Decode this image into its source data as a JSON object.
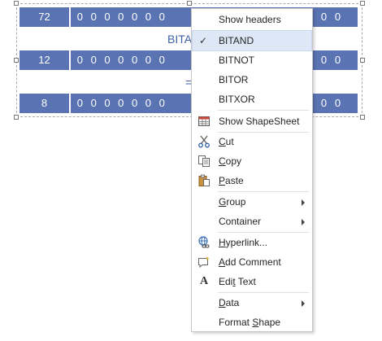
{
  "diagram": {
    "rows": [
      {
        "number": "72",
        "bits_left": [
          "0",
          "0",
          "0",
          "0",
          "0",
          "0",
          "0"
        ],
        "bits_right": [
          "0",
          "0"
        ]
      },
      {
        "number": "12",
        "bits_left": [
          "0",
          "0",
          "0",
          "0",
          "0",
          "0",
          "0"
        ],
        "bits_right": [
          "0",
          "0"
        ]
      },
      {
        "number": "8",
        "bits_left": [
          "0",
          "0",
          "0",
          "0",
          "0",
          "0",
          "0"
        ],
        "bits_right": [
          "0",
          "0"
        ]
      }
    ],
    "operation_label": "BITA",
    "equals_label": "="
  },
  "menu": {
    "items": [
      {
        "label": "Show headers",
        "icon": "",
        "checked": false,
        "submenu": false,
        "highlight": false
      },
      {
        "label": "BITAND",
        "icon": "check-icon",
        "checked": true,
        "submenu": false,
        "highlight": true
      },
      {
        "label": "BITNOT",
        "icon": "",
        "checked": false,
        "submenu": false,
        "highlight": false
      },
      {
        "label": "BITOR",
        "icon": "",
        "checked": false,
        "submenu": false,
        "highlight": false
      },
      {
        "label": "BITXOR",
        "icon": "",
        "checked": false,
        "submenu": false,
        "highlight": false
      },
      {
        "label": "Show ShapeSheet",
        "icon": "shapesheet-icon",
        "checked": false,
        "submenu": false,
        "highlight": false
      },
      {
        "label": "Cut",
        "icon": "scissors-icon",
        "checked": false,
        "submenu": false,
        "highlight": false
      },
      {
        "label": "Copy",
        "icon": "copy-icon",
        "checked": false,
        "submenu": false,
        "highlight": false
      },
      {
        "label": "Paste",
        "icon": "paste-icon",
        "checked": false,
        "submenu": false,
        "highlight": false
      },
      {
        "label": "Group",
        "icon": "",
        "checked": false,
        "submenu": true,
        "highlight": false
      },
      {
        "label": "Container",
        "icon": "",
        "checked": false,
        "submenu": true,
        "highlight": false
      },
      {
        "label": "Hyperlink...",
        "icon": "hyperlink-icon",
        "checked": false,
        "submenu": false,
        "highlight": false
      },
      {
        "label": "Add Comment",
        "icon": "comment-icon",
        "checked": false,
        "submenu": false,
        "highlight": false
      },
      {
        "label": "Edit Text",
        "icon": "text-icon",
        "checked": false,
        "submenu": false,
        "highlight": false
      },
      {
        "label": "Data",
        "icon": "",
        "checked": false,
        "submenu": true,
        "highlight": false
      },
      {
        "label": "Format Shape",
        "icon": "",
        "checked": false,
        "submenu": false,
        "highlight": false
      }
    ]
  },
  "colors": {
    "bar_blue": "#5a73b3",
    "label_blue": "#3f5fa9",
    "highlight": "#dde7f5"
  }
}
